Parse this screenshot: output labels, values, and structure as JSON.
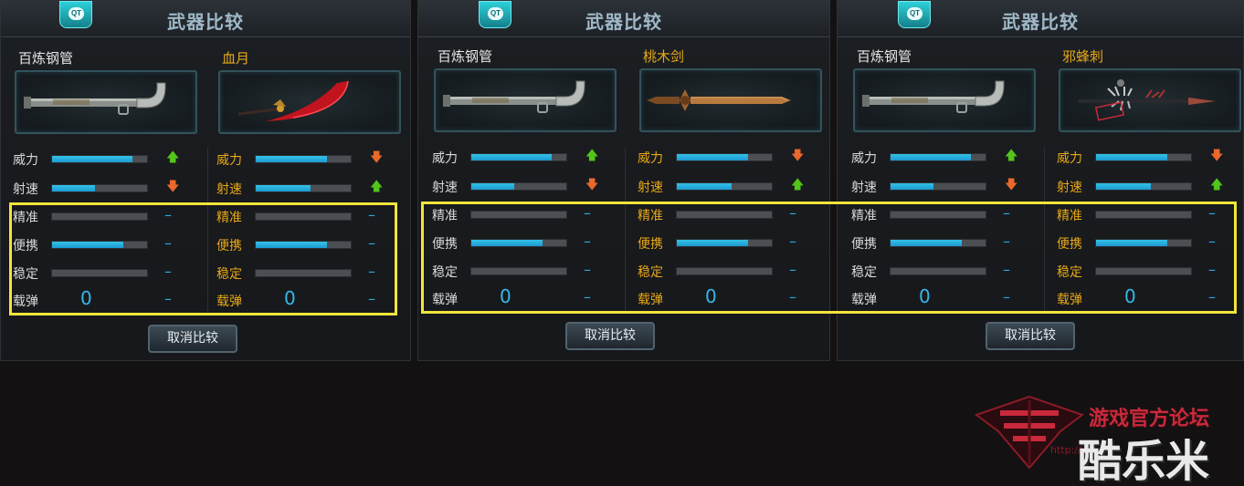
{
  "panels": [
    {
      "title": "武器比较",
      "weapons": [
        {
          "name": "百炼钢管",
          "name_color": "white",
          "image": "steel-pipe",
          "stats": [
            {
              "label": "威力",
              "value": 0.85,
              "indicator": "up"
            },
            {
              "label": "射速",
              "value": 0.45,
              "indicator": "down"
            },
            {
              "label": "精准",
              "value": 0.0,
              "indicator": "–"
            },
            {
              "label": "便携",
              "value": 0.75,
              "indicator": "–"
            },
            {
              "label": "稳定",
              "value": 0.0,
              "indicator": "–"
            }
          ],
          "ammo_label": "载弹",
          "ammo_value": "0",
          "ammo_indicator": "–"
        },
        {
          "name": "血月",
          "name_color": "gold",
          "image": "blood-moon-blade",
          "stats": [
            {
              "label": "威力",
              "value": 0.75,
              "indicator": "down"
            },
            {
              "label": "射速",
              "value": 0.58,
              "indicator": "up"
            },
            {
              "label": "精准",
              "value": 0.0,
              "indicator": "–"
            },
            {
              "label": "便携",
              "value": 0.75,
              "indicator": "–"
            },
            {
              "label": "稳定",
              "value": 0.0,
              "indicator": "–"
            }
          ],
          "ammo_label": "载弹",
          "ammo_value": "0",
          "ammo_indicator": "–"
        }
      ],
      "cancel_label": "取消比较"
    },
    {
      "title": "武器比较",
      "weapons": [
        {
          "name": "百炼钢管",
          "name_color": "white",
          "image": "steel-pipe",
          "stats": [
            {
              "label": "威力",
              "value": 0.85,
              "indicator": "up"
            },
            {
              "label": "射速",
              "value": 0.45,
              "indicator": "down"
            },
            {
              "label": "精准",
              "value": 0.0,
              "indicator": "–"
            },
            {
              "label": "便携",
              "value": 0.75,
              "indicator": "–"
            },
            {
              "label": "稳定",
              "value": 0.0,
              "indicator": "–"
            }
          ],
          "ammo_label": "载弹",
          "ammo_value": "0",
          "ammo_indicator": "–"
        },
        {
          "name": "桃木剑",
          "name_color": "gold",
          "image": "peachwood-sword",
          "stats": [
            {
              "label": "威力",
              "value": 0.75,
              "indicator": "down"
            },
            {
              "label": "射速",
              "value": 0.58,
              "indicator": "up"
            },
            {
              "label": "精准",
              "value": 0.0,
              "indicator": "–"
            },
            {
              "label": "便携",
              "value": 0.75,
              "indicator": "–"
            },
            {
              "label": "稳定",
              "value": 0.0,
              "indicator": "–"
            }
          ],
          "ammo_label": "载弹",
          "ammo_value": "0",
          "ammo_indicator": "–"
        }
      ],
      "cancel_label": "取消比较"
    },
    {
      "title": "武器比较",
      "weapons": [
        {
          "name": "百炼钢管",
          "name_color": "white",
          "image": "steel-pipe",
          "stats": [
            {
              "label": "威力",
              "value": 0.85,
              "indicator": "up"
            },
            {
              "label": "射速",
              "value": 0.45,
              "indicator": "down"
            },
            {
              "label": "精准",
              "value": 0.0,
              "indicator": "–"
            },
            {
              "label": "便携",
              "value": 0.75,
              "indicator": "–"
            },
            {
              "label": "稳定",
              "value": 0.0,
              "indicator": "–"
            }
          ],
          "ammo_label": "载弹",
          "ammo_value": "0",
          "ammo_indicator": "–"
        },
        {
          "name": "邪蜂刺",
          "name_color": "gold",
          "image": "evil-wasp-spear",
          "stats": [
            {
              "label": "威力",
              "value": 0.75,
              "indicator": "down"
            },
            {
              "label": "射速",
              "value": 0.58,
              "indicator": "up"
            },
            {
              "label": "精准",
              "value": 0.0,
              "indicator": "–"
            },
            {
              "label": "便携",
              "value": 0.75,
              "indicator": "–"
            },
            {
              "label": "稳定",
              "value": 0.0,
              "indicator": "–"
            }
          ],
          "ammo_label": "载弹",
          "ammo_value": "0",
          "ammo_indicator": "–"
        }
      ],
      "cancel_label": "取消比较"
    }
  ],
  "badge_glyph": "QT",
  "colors": {
    "accent": "#28a9e0",
    "gold": "#e8a817",
    "up": "#52c41a",
    "down": "#e8692a",
    "highlight": "#f2e53a"
  },
  "watermark": {
    "forum_label": "游戏官方论坛",
    "site_label": "酷乐米",
    "url_fragment": "http://"
  }
}
